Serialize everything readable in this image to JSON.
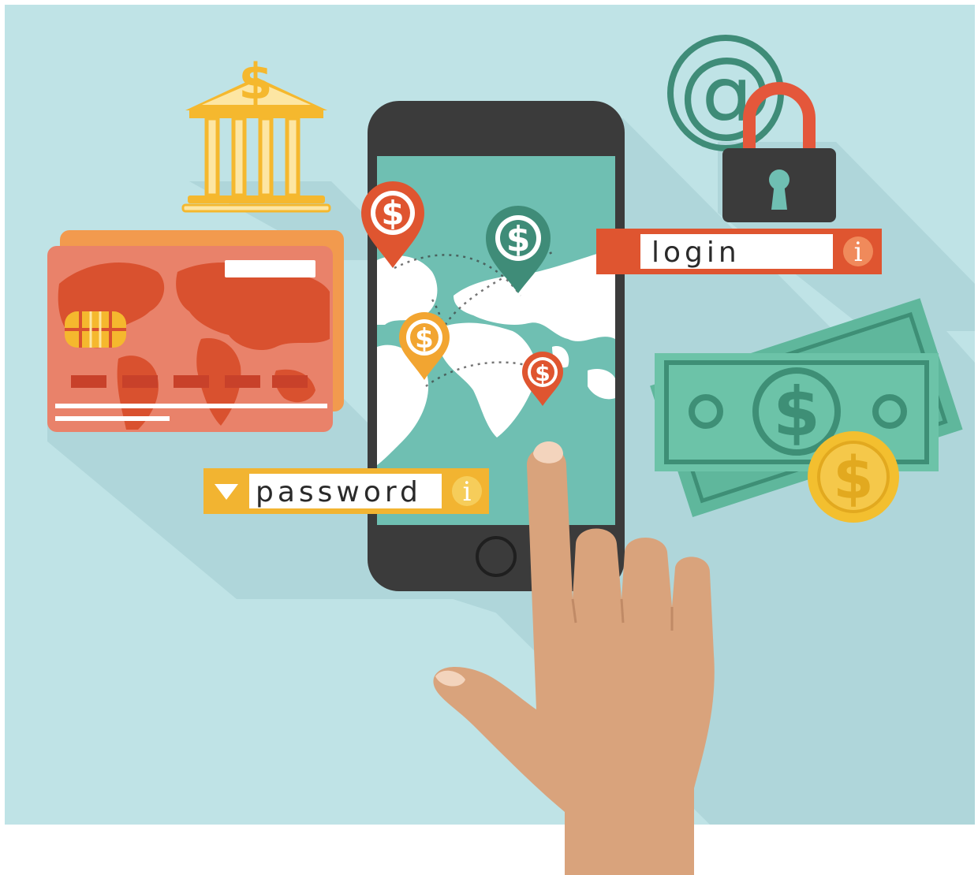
{
  "colors": {
    "background": "#bfe3e6",
    "shadow": "#aed5d9",
    "phone_body": "#3b3b3b",
    "screen": "#6fbfb2",
    "card_front": "#e9826a",
    "card_back": "#f29a4e",
    "card_map": "#d9512f",
    "bank": "#f5b82e",
    "lock_shackle": "#e4573b",
    "lock_body": "#3b3b3b",
    "at_sign": "#3f8c78",
    "login_accent": "#df5530",
    "password_accent": "#f2b431",
    "money": "#5fb79c",
    "money_dark": "#3e8f76",
    "coin": "#f3bf2f",
    "skin": "#d9a37c",
    "map_land": "#ffffff"
  },
  "icons": {
    "bank": "bank-building-icon",
    "card": "credit-card-icon",
    "lock": "padlock-icon",
    "email": "at-sign-icon",
    "money": "banknote-icon",
    "coin": "coin-icon",
    "pin": "location-pin-icon",
    "dropdown": "triangle-down-icon",
    "info": "info-icon",
    "hand": "pointing-hand-icon"
  },
  "login_field": {
    "value": "login",
    "info_glyph": "i"
  },
  "password_field": {
    "value": "password",
    "info_glyph": "i"
  },
  "symbols": {
    "dollar": "$",
    "at": "@"
  }
}
